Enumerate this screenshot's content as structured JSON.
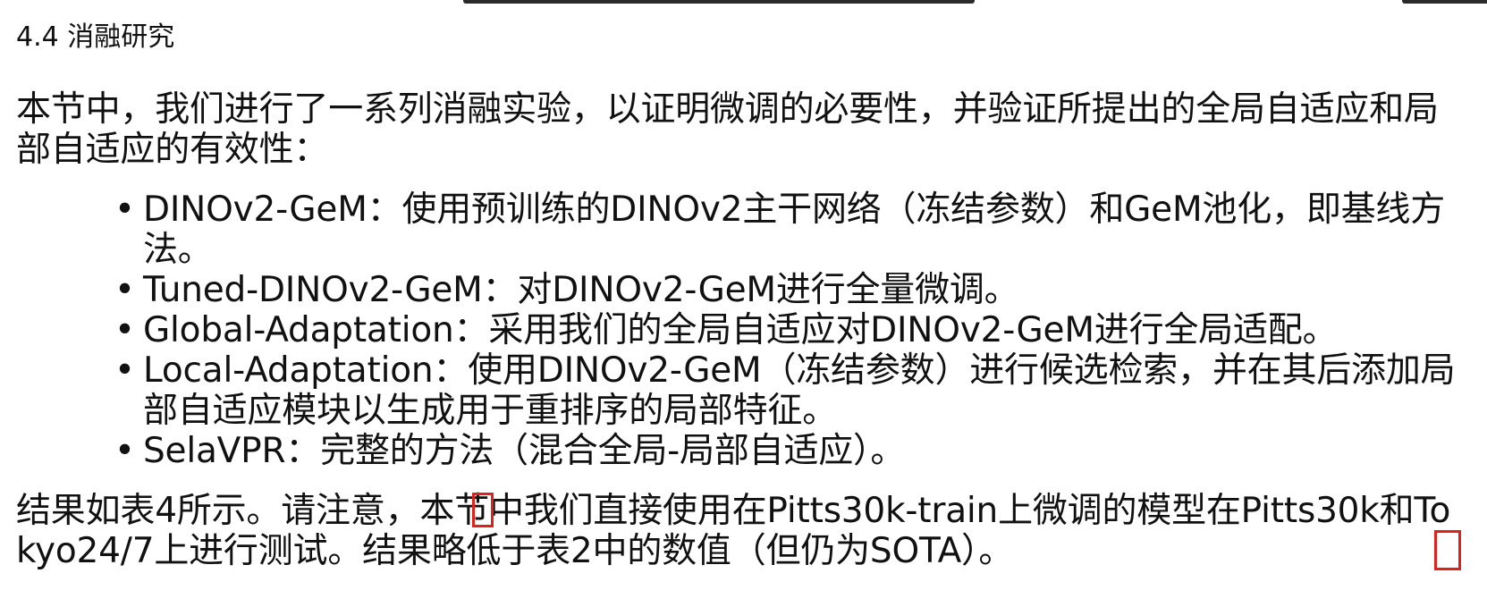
{
  "section": {
    "title": "4.4 消融研究"
  },
  "intro": {
    "text": "本节中，我们进行了一系列消融实验，以证明微调的必要性，并验证所提出的全局自适应和局部自适应的有效性："
  },
  "bullets": [
    {
      "marker": "•",
      "text": "DINOv2-GeM：使用预训练的DINOv2主干网络（冻结参数）和GeM池化，即基线方法。"
    },
    {
      "marker": "•",
      "text": "Tuned-DINOv2-GeM：对DINOv2-GeM进行全量微调。"
    },
    {
      "marker": "•",
      "text": "Global-Adaptation：采用我们的全局自适应对DINOv2-GeM进行全局适配。"
    },
    {
      "marker": "•",
      "text": "Local-Adaptation：使用DINOv2-GeM（冻结参数）进行候选检索，并在其后添加局部自适应模块以生成用于重排序的局部特征。"
    },
    {
      "marker": "•",
      "text": "SelaVPR：完整的方法（混合全局-局部自适应）。"
    }
  ],
  "result": {
    "text": "结果如表4所示。请注意，本节中我们直接使用在Pitts30k-train上微调的模型在Pitts30k和Tokyo24/7上进行测试。结果略低于表2中的数值（但仍为SOTA）。"
  },
  "colors": {
    "text": "#111111",
    "marker": "#e0201b",
    "background": "#ffffff"
  }
}
